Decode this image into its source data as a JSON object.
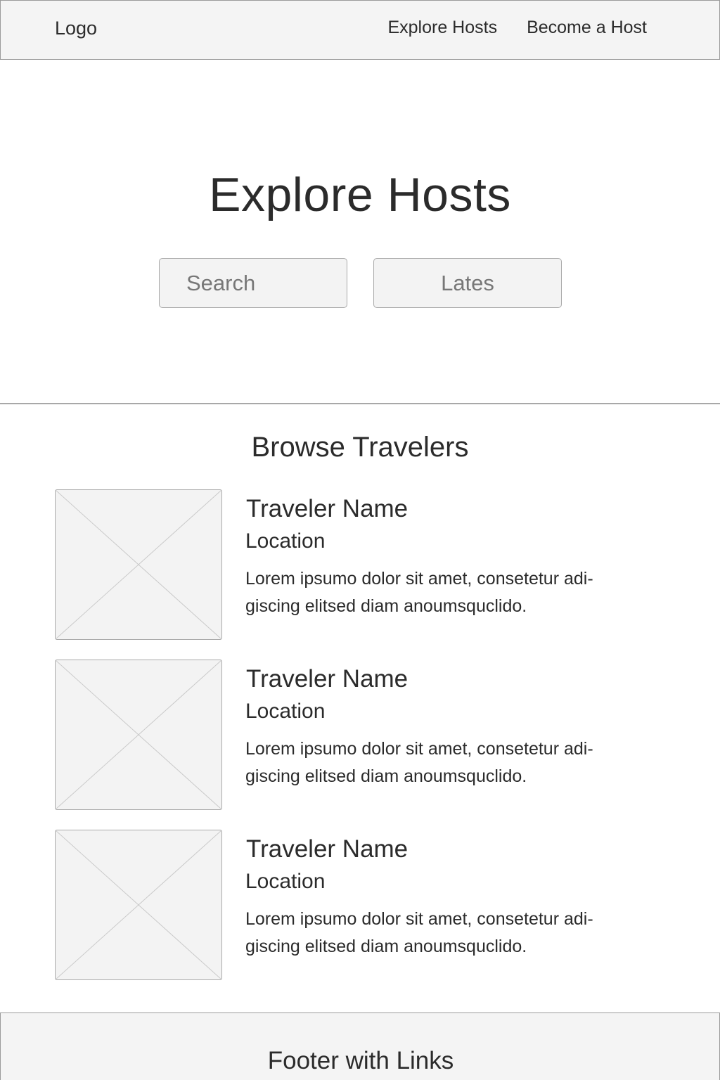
{
  "header": {
    "logo": "Logo",
    "nav": [
      "Explore Hosts",
      "Become a Host"
    ]
  },
  "hero": {
    "title": "Explore Hosts",
    "search_placeholder": "Search",
    "sort_value": "Lates"
  },
  "section": {
    "title": "Browse Travelers"
  },
  "travelers": [
    {
      "name": "Traveler Name",
      "location": "Location",
      "description": "Lorem ipsumo dolor sit amet, consetetur adi-giscing elitsed diam anoumsquclido."
    },
    {
      "name": "Traveler Name",
      "location": "Location",
      "description": "Lorem ipsumo dolor sit amet, consetetur adi-giscing elitsed diam anoumsquclido."
    },
    {
      "name": "Traveler Name",
      "location": "Location",
      "description": "Lorem ipsumo dolor sit amet, consetetur adi-giscing elitsed diam anoumsquclido."
    }
  ],
  "footer": {
    "text": "Footer with Links"
  },
  "colors": {
    "background": "#ffffff",
    "panel": "#f4f4f4",
    "border": "#9a9a9a",
    "text": "#2b2b2b",
    "placeholder_text": "#777777"
  }
}
